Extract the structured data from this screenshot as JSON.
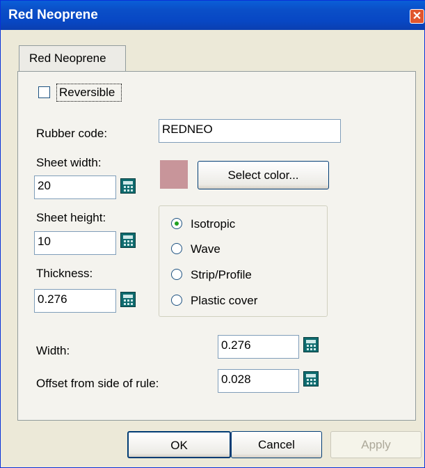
{
  "window": {
    "title": "Red Neoprene"
  },
  "tab": {
    "label": "Red Neoprene"
  },
  "reversible": {
    "label": "Reversible",
    "checked": false
  },
  "rubber_code": {
    "label": "Rubber code:",
    "value": "REDNEO"
  },
  "sheet_width": {
    "label": "Sheet width:",
    "value": "20"
  },
  "sheet_height": {
    "label": "Sheet height:",
    "value": "10"
  },
  "thickness": {
    "label": "Thickness:",
    "value": "0.276"
  },
  "color": {
    "swatch": "#c8959a",
    "button_label": "Select color..."
  },
  "type_options": {
    "selected": "Isotropic",
    "items": [
      "Isotropic",
      "Wave",
      "Strip/Profile",
      "Plastic cover"
    ]
  },
  "width": {
    "label": "Width:",
    "value": "0.276"
  },
  "offset": {
    "label": "Offset from side of rule:",
    "value": "0.028"
  },
  "buttons": {
    "ok": "OK",
    "cancel": "Cancel",
    "apply": "Apply"
  },
  "icons": {
    "calculator": "calculator-icon",
    "close": "close-icon"
  }
}
